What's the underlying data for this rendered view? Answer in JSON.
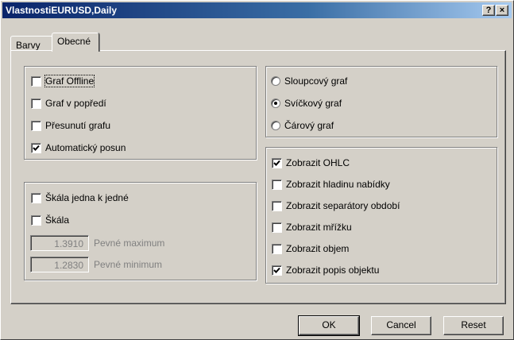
{
  "window": {
    "title": "VlastnostiEURUSD,Daily",
    "help_label": "?",
    "close_label": "×"
  },
  "tabs": [
    {
      "label": "Barvy",
      "active": false
    },
    {
      "label": "Obecné",
      "active": true
    }
  ],
  "general_options": [
    {
      "label": "Graf Offline",
      "checked": false
    },
    {
      "label": "Graf v popředí",
      "checked": false
    },
    {
      "label": "Přesunutí grafu",
      "checked": false
    },
    {
      "label": "Automatický posun",
      "checked": true
    }
  ],
  "scale_options": [
    {
      "label": "Škála jedna k jedné",
      "checked": false
    },
    {
      "label": "Škála",
      "checked": false
    }
  ],
  "fixed_max": {
    "value": "1.3910",
    "label": "Pevné maximum"
  },
  "fixed_min": {
    "value": "1.2830",
    "label": "Pevné minimum"
  },
  "chart_types": [
    {
      "label": "Sloupcový graf",
      "selected": false
    },
    {
      "label": "Svíčkový graf",
      "selected": true
    },
    {
      "label": "Čárový graf",
      "selected": false
    }
  ],
  "display_options": [
    {
      "label": "Zobrazit OHLC",
      "checked": true
    },
    {
      "label": "Zobrazit hladinu nabídky",
      "checked": false
    },
    {
      "label": "Zobrazit separátory období",
      "checked": false
    },
    {
      "label": "Zobrazit mřížku",
      "checked": false
    },
    {
      "label": "Zobrazit objem",
      "checked": false
    },
    {
      "label": "Zobrazit popis objektu",
      "checked": true
    }
  ],
  "buttons": {
    "ok": "OK",
    "cancel": "Cancel",
    "reset": "Reset"
  }
}
